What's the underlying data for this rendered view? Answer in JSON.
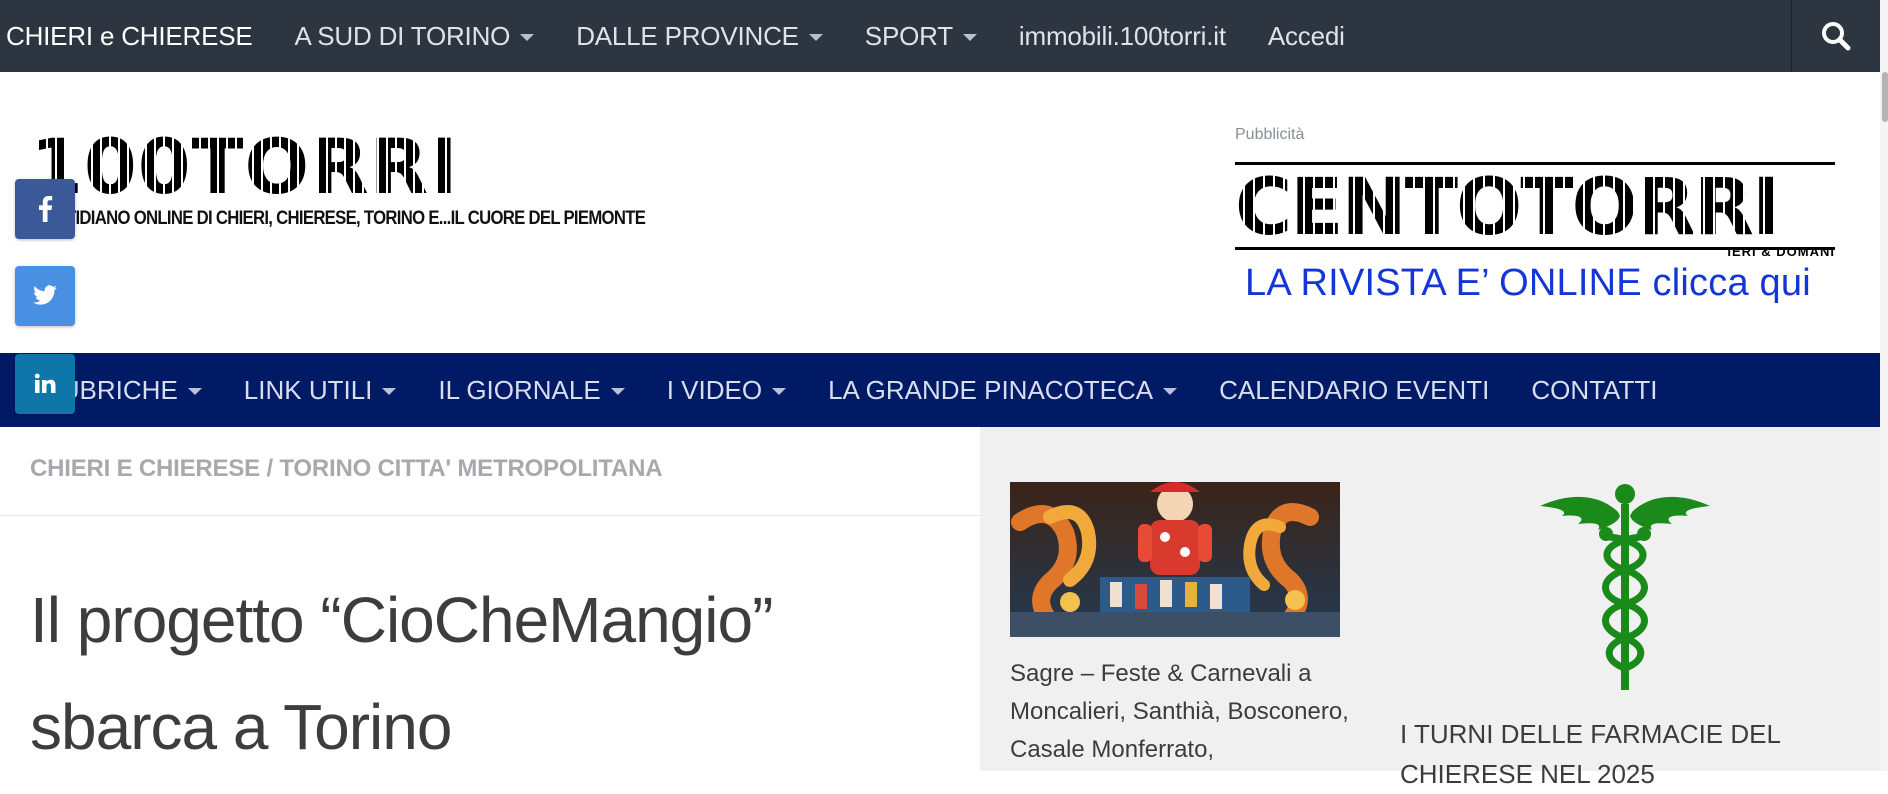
{
  "topbar": {
    "items": [
      {
        "label": "CHIERI e CHIERESE",
        "has_dropdown": false
      },
      {
        "label": "A SUD DI TORINO",
        "has_dropdown": true
      },
      {
        "label": "DALLE PROVINCE",
        "has_dropdown": true
      },
      {
        "label": "SPORT",
        "has_dropdown": true
      },
      {
        "label": "immobili.100torri.it",
        "has_dropdown": false
      },
      {
        "label": "Accedi",
        "has_dropdown": false
      }
    ],
    "search_icon": "search-icon",
    "background": "#2d3540"
  },
  "header": {
    "logo": {
      "letters": [
        "1",
        "0",
        "0",
        "T",
        "O",
        "R",
        "R",
        "I"
      ],
      "tagline": "QUOTIDIANO ONLINE DI CHIERI, CHIERESE, TORINO E...IL CUORE DEL PIEMONTE"
    },
    "advertising": {
      "label": "Pubblicità",
      "banner_title": "CENTOTORRI",
      "banner_subtitle": "IERI & DOMANI",
      "banner_cta": "LA RIVISTA E’ ONLINE clicca qui",
      "cta_color": "#1536d6"
    }
  },
  "social": [
    {
      "icon": "facebook-icon",
      "glyph": "f",
      "color": "#3b5998"
    },
    {
      "icon": "twitter-icon",
      "glyph": "bird",
      "color": "#4a90e2"
    },
    {
      "icon": "linkedin-icon",
      "glyph": "in",
      "color": "#0e76a8"
    }
  ],
  "mainnav": {
    "items": [
      {
        "label": "RUBRICHE",
        "has_dropdown": true
      },
      {
        "label": "LINK UTILI",
        "has_dropdown": true
      },
      {
        "label": "IL GIORNALE",
        "has_dropdown": true
      },
      {
        "label": "I VIDEO",
        "has_dropdown": true
      },
      {
        "label": "LA GRANDE PINACOTECA",
        "has_dropdown": true
      },
      {
        "label": "CALENDARIO EVENTI",
        "has_dropdown": false
      },
      {
        "label": "CONTATTI",
        "has_dropdown": false
      }
    ],
    "background": "#001a66"
  },
  "article": {
    "breadcrumb": "CHIERI E CHIERESE / TORINO CITTA' METROPOLITANA",
    "title": "Il progetto “CioCheMangio” sbarca a Torino"
  },
  "sidebar": {
    "post1": {
      "title": "Sagre – Feste & Carnevali a Moncalieri, Santhià, Bosconero, Casale Monferrato,"
    },
    "post2": {
      "icon": "caduceus-icon",
      "icon_color": "#1a8a1a",
      "title": "I TURNI DELLE FARMACIE DEL CHIERESE NEL 2025"
    }
  }
}
